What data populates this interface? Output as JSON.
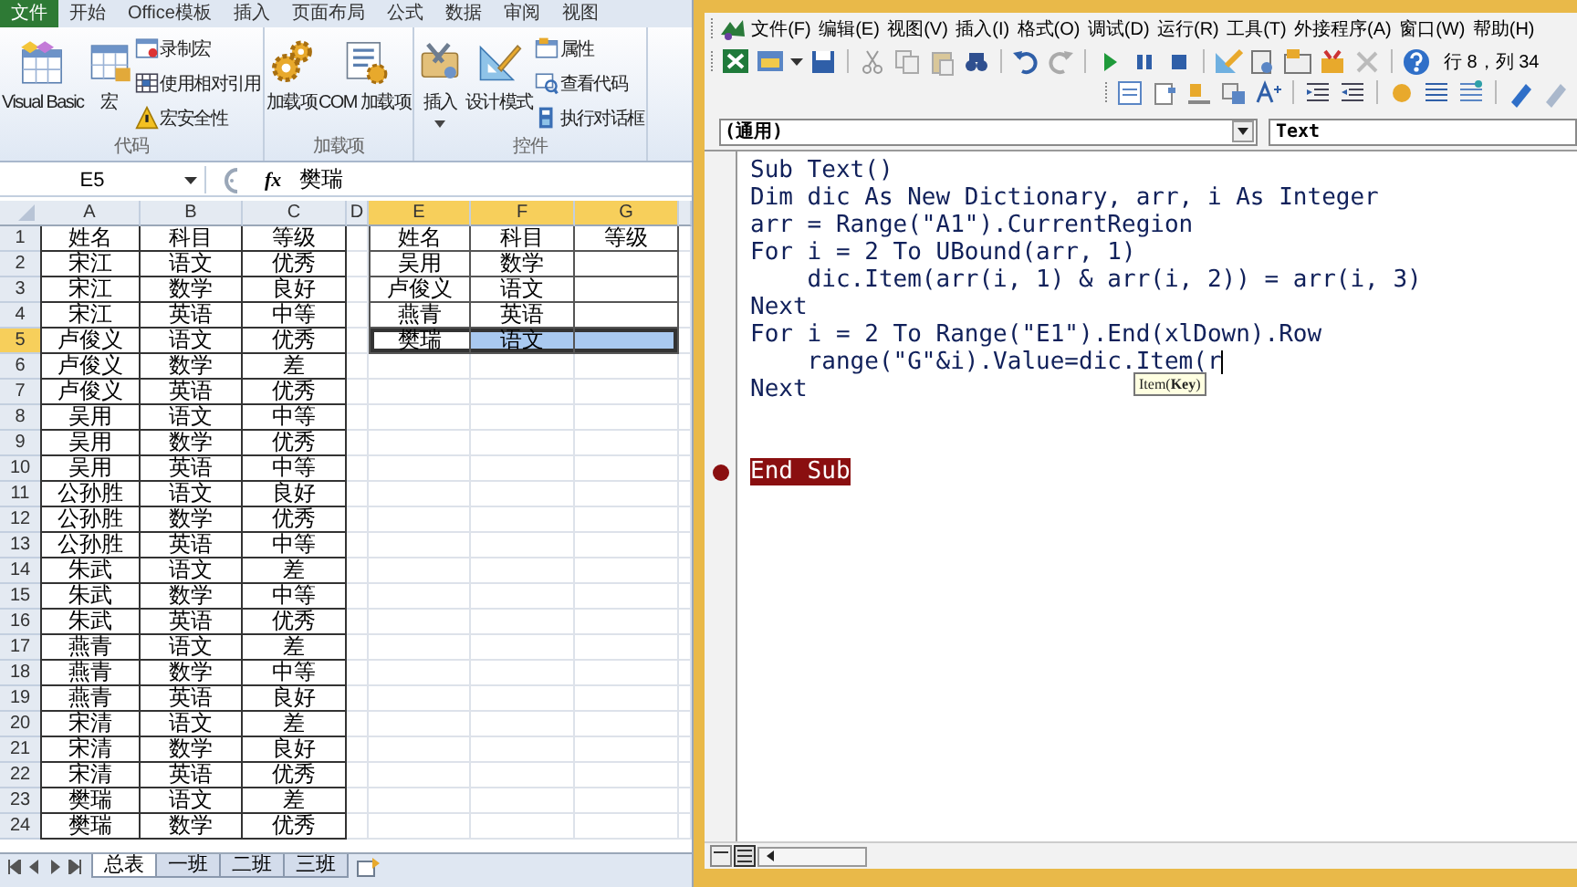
{
  "excel": {
    "ribbon_tabs": [
      {
        "label": "文件",
        "selected": true
      },
      {
        "label": "开始",
        "selected": false
      },
      {
        "label": "Office模板",
        "selected": false
      },
      {
        "label": "插入",
        "selected": false
      },
      {
        "label": "页面布局",
        "selected": false
      },
      {
        "label": "公式",
        "selected": false
      },
      {
        "label": "数据",
        "selected": false
      },
      {
        "label": "审阅",
        "selected": false
      },
      {
        "label": "视图",
        "selected": false
      }
    ],
    "ribbon_groups": [
      {
        "label": "代码",
        "items": [
          {
            "label": "Visual Basic",
            "kind": "large"
          },
          {
            "label": "宏",
            "kind": "large"
          },
          {
            "label": "录制宏",
            "kind": "small"
          },
          {
            "label": "使用相对引用",
            "kind": "small"
          },
          {
            "label": "宏安全性",
            "kind": "small"
          }
        ]
      },
      {
        "label": "加载项",
        "items": [
          {
            "label": "加载项",
            "kind": "large"
          },
          {
            "label": "COM 加载项",
            "kind": "large"
          }
        ]
      },
      {
        "label": "控件",
        "items": [
          {
            "label": "插入",
            "kind": "dropdown"
          },
          {
            "label": "设计模式",
            "kind": "large"
          },
          {
            "label": "属性",
            "kind": "small"
          },
          {
            "label": "查看代码",
            "kind": "small"
          },
          {
            "label": "执行对话框",
            "kind": "small"
          }
        ]
      }
    ],
    "name_box": "E5",
    "function_label": "fx",
    "formula": "樊瑞",
    "columns": [
      {
        "label": "A",
        "selected": false
      },
      {
        "label": "B",
        "selected": false
      },
      {
        "label": "C",
        "selected": false
      },
      {
        "label": "D",
        "selected": false
      },
      {
        "label": "E",
        "selected": true
      },
      {
        "label": "F",
        "selected": true
      },
      {
        "label": "G",
        "selected": true
      }
    ],
    "rows": [
      {
        "number": "1",
        "selected": false,
        "cells": [
          "姓名",
          "科目",
          "等级"
        ],
        "lookup": [
          {
            "text": "姓名",
            "selected": false,
            "active": false
          },
          {
            "text": "科目",
            "selected": false,
            "active": false
          },
          {
            "text": "等级",
            "selected": false,
            "active": false
          }
        ]
      },
      {
        "number": "2",
        "selected": false,
        "cells": [
          "宋江",
          "语文",
          "优秀"
        ],
        "lookup": [
          {
            "text": "吴用",
            "selected": false,
            "active": false
          },
          {
            "text": "数学",
            "selected": false,
            "active": false
          },
          {
            "selected": false,
            "active": false
          }
        ]
      },
      {
        "number": "3",
        "selected": false,
        "cells": [
          "宋江",
          "数学",
          "良好"
        ],
        "lookup": [
          {
            "text": "卢俊义",
            "selected": false,
            "active": false
          },
          {
            "text": "语文",
            "selected": false,
            "active": false
          },
          {
            "selected": false,
            "active": false
          }
        ]
      },
      {
        "number": "4",
        "selected": false,
        "cells": [
          "宋江",
          "英语",
          "中等"
        ],
        "lookup": [
          {
            "text": "燕青",
            "selected": false,
            "active": false
          },
          {
            "text": "英语",
            "selected": false,
            "active": false
          },
          {
            "selected": false,
            "active": false
          }
        ]
      },
      {
        "number": "5",
        "selected": true,
        "cells": [
          "卢俊义",
          "语文",
          "优秀"
        ],
        "lookup": [
          {
            "text": "樊瑞",
            "selected": true,
            "active": true
          },
          {
            "text": "语文",
            "selected": true,
            "active": false
          },
          {
            "selected": true,
            "active": false
          }
        ]
      },
      {
        "number": "6",
        "selected": false,
        "cells": [
          "卢俊义",
          "数学",
          "差"
        ]
      },
      {
        "number": "7",
        "selected": false,
        "cells": [
          "卢俊义",
          "英语",
          "优秀"
        ]
      },
      {
        "number": "8",
        "selected": false,
        "cells": [
          "吴用",
          "语文",
          "中等"
        ]
      },
      {
        "number": "9",
        "selected": false,
        "cells": [
          "吴用",
          "数学",
          "优秀"
        ]
      },
      {
        "number": "10",
        "selected": false,
        "cells": [
          "吴用",
          "英语",
          "中等"
        ]
      },
      {
        "number": "11",
        "selected": false,
        "cells": [
          "公孙胜",
          "语文",
          "良好"
        ]
      },
      {
        "number": "12",
        "selected": false,
        "cells": [
          "公孙胜",
          "数学",
          "优秀"
        ]
      },
      {
        "number": "13",
        "selected": false,
        "cells": [
          "公孙胜",
          "英语",
          "中等"
        ]
      },
      {
        "number": "14",
        "selected": false,
        "cells": [
          "朱武",
          "语文",
          "差"
        ]
      },
      {
        "number": "15",
        "selected": false,
        "cells": [
          "朱武",
          "数学",
          "中等"
        ]
      },
      {
        "number": "16",
        "selected": false,
        "cells": [
          "朱武",
          "英语",
          "优秀"
        ]
      },
      {
        "number": "17",
        "selected": false,
        "cells": [
          "燕青",
          "语文",
          "差"
        ]
      },
      {
        "number": "18",
        "selected": false,
        "cells": [
          "燕青",
          "数学",
          "中等"
        ]
      },
      {
        "number": "19",
        "selected": false,
        "cells": [
          "燕青",
          "英语",
          "良好"
        ]
      },
      {
        "number": "20",
        "selected": false,
        "cells": [
          "宋清",
          "语文",
          "差"
        ]
      },
      {
        "number": "21",
        "selected": false,
        "cells": [
          "宋清",
          "数学",
          "良好"
        ]
      },
      {
        "number": "22",
        "selected": false,
        "cells": [
          "宋清",
          "英语",
          "优秀"
        ]
      },
      {
        "number": "23",
        "selected": false,
        "cells": [
          "樊瑞",
          "语文",
          "差"
        ]
      },
      {
        "number": "24",
        "selected": false,
        "cells": [
          "樊瑞",
          "数学",
          "优秀"
        ]
      }
    ],
    "sheet_tabs": [
      {
        "label": "总表",
        "selected": true
      },
      {
        "label": "一班",
        "selected": false
      },
      {
        "label": "二班",
        "selected": false
      },
      {
        "label": "三班",
        "selected": false
      }
    ]
  },
  "vba": {
    "menu": [
      "文件(F)",
      "编辑(E)",
      "视图(V)",
      "插入(I)",
      "格式(O)",
      "调试(D)",
      "运行(R)",
      "工具(T)",
      "外接程序(A)",
      "窗口(W)",
      "帮助(H)"
    ],
    "cursor_position": "行 8，列 34",
    "object_box": "(通用)",
    "procedure_box": "Text",
    "code_lines": [
      {
        "kind": "code",
        "text": "Sub Text()",
        "breakpoint": false
      },
      {
        "kind": "code",
        "text": "Dim dic As New Dictionary, arr, i As Integer",
        "breakpoint": false
      },
      {
        "kind": "code",
        "text": "arr = Range(\"A1\").CurrentRegion",
        "breakpoint": false
      },
      {
        "kind": "code",
        "text": "For i = 2 To UBound(arr, 1)",
        "breakpoint": false
      },
      {
        "kind": "code",
        "text": "    dic.Item(arr(i, 1) & arr(i, 2)) = arr(i, 3)",
        "breakpoint": false
      },
      {
        "kind": "code",
        "text": "Next",
        "breakpoint": false
      },
      {
        "kind": "code",
        "text": "For i = 2 To Range(\"E1\").End(xlDown).Row",
        "breakpoint": false
      },
      {
        "kind": "code",
        "text": "    range(\"G\"&i).Value=dic.Item(r",
        "breakpoint": false,
        "caret": true
      },
      {
        "kind": "code",
        "text": "Next",
        "breakpoint": false
      },
      {
        "kind": "blank"
      },
      {
        "kind": "blank"
      },
      {
        "kind": "code",
        "text": "End Sub",
        "breakpoint": true
      }
    ],
    "tooltip": "Item(**Key**)"
  }
}
